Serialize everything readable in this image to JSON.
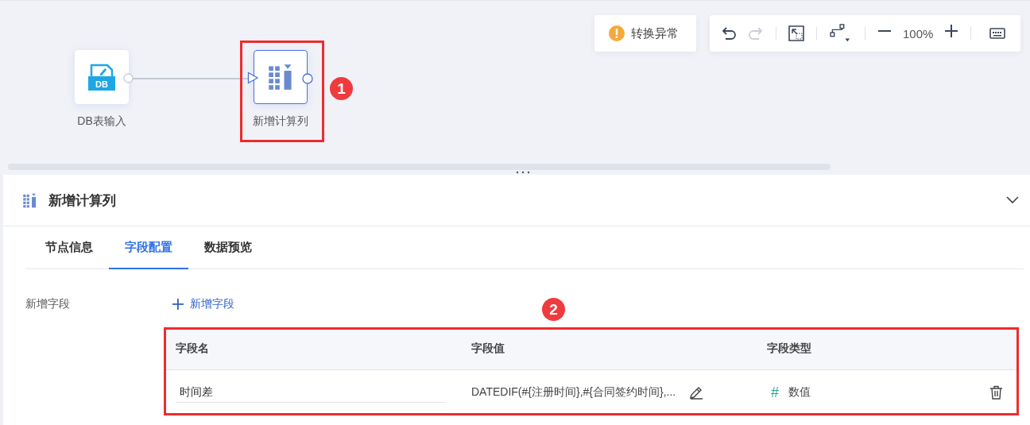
{
  "canvas": {
    "status_button": {
      "label": "转换异常"
    },
    "toolbar": {
      "zoom": "100%",
      "redo_disabled": true
    },
    "nodes": [
      {
        "label": "DB表输入",
        "kind": "db",
        "icon_text": "DB",
        "selected": false
      },
      {
        "label": "新增计算列",
        "kind": "calc",
        "selected": true
      }
    ]
  },
  "annotations": [
    {
      "label": "1"
    },
    {
      "label": "2"
    }
  ],
  "panel": {
    "title": "新增计算列",
    "tabs": [
      {
        "label": "节点信息",
        "selected": false
      },
      {
        "label": "字段配置",
        "selected": true
      },
      {
        "label": "数据预览",
        "selected": false
      }
    ],
    "field_label": "新增字段",
    "add_button": "新增字段",
    "table": {
      "columns": [
        "字段名",
        "字段值",
        "字段类型"
      ],
      "rows": [
        {
          "name": "时间差",
          "value": "DATEDIF(#{注册时间},#{合同签约时间},...",
          "type_icon": "#",
          "type": "数值"
        }
      ]
    }
  }
}
